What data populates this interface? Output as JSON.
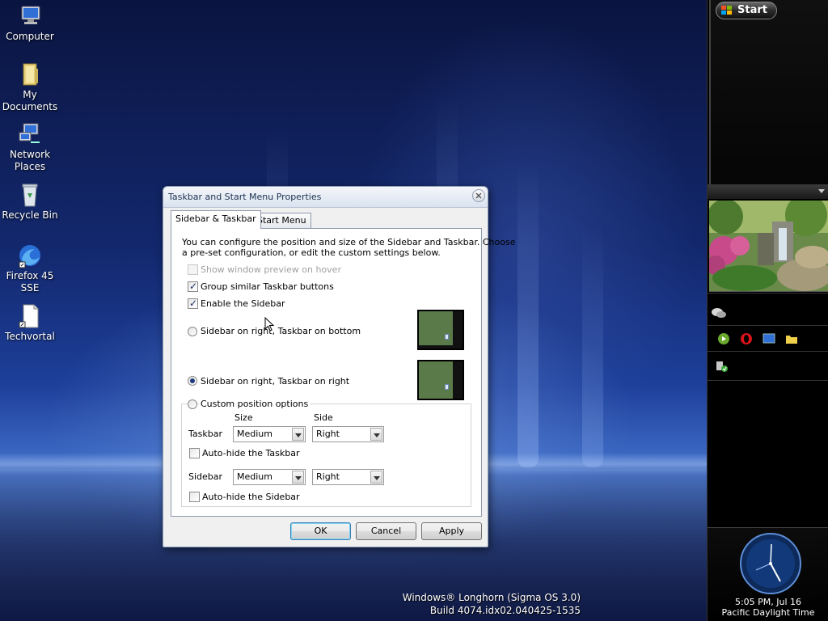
{
  "desktop": {
    "icons": [
      {
        "label": "Computer",
        "icon": "computer-icon"
      },
      {
        "label": "My Documents",
        "icon": "folder-icon"
      },
      {
        "label": "Network Places",
        "icon": "network-icon"
      },
      {
        "label": "Recycle Bin",
        "icon": "recycle-bin-icon"
      },
      {
        "label": "Firefox 45 SSE",
        "icon": "firefox-icon"
      },
      {
        "label": "Techvortal",
        "icon": "document-icon"
      }
    ],
    "watermark_line1": "Windows® Longhorn (Sigma OS 3.0)",
    "watermark_line2": "Build 4074.idx02.040425-1535"
  },
  "sidebar": {
    "start_label": "Start",
    "clock_time": "5:05 PM, Jul 16",
    "clock_zone": "Pacific Daylight Time"
  },
  "dialog": {
    "title": "Taskbar and Start Menu Properties",
    "tabs": [
      "Sidebar & Taskbar",
      "Start Menu"
    ],
    "active_tab": 0,
    "description": "You can configure the position and size of the Sidebar and Taskbar. Choose a pre-set configuration, or edit the custom settings below.",
    "description_line1": "You can configure the position and size of the Sidebar and Taskbar. Choose",
    "description_line2": "a pre-set configuration, or edit the custom settings below.",
    "options": {
      "show_preview": {
        "label": "Show window preview on hover",
        "checked": false,
        "disabled": true
      },
      "group_buttons": {
        "label": "Group similar Taskbar buttons",
        "checked": true
      },
      "enable_sidebar": {
        "label": "Enable the Sidebar",
        "checked": true
      }
    },
    "positions": {
      "right_bottom": {
        "label": "Sidebar on right, Taskbar on bottom",
        "selected": false
      },
      "right_right": {
        "label": "Sidebar on right, Taskbar on right",
        "selected": true
      },
      "custom": {
        "label": "Custom position options",
        "selected": false
      }
    },
    "custom": {
      "size_header": "Size",
      "side_header": "Side",
      "taskbar_label": "Taskbar",
      "taskbar_size": "Medium",
      "taskbar_side": "Right",
      "autohide_taskbar": "Auto-hide the Taskbar",
      "sidebar_label": "Sidebar",
      "sidebar_size": "Medium",
      "sidebar_side": "Right",
      "autohide_sidebar": "Auto-hide the Sidebar"
    },
    "buttons": {
      "ok": "OK",
      "cancel": "Cancel",
      "apply": "Apply"
    }
  },
  "colors": {
    "desktop_blue": "#13286d",
    "sidebar_black": "#000000",
    "dialog_face": "#f0f0f0",
    "default_button_border": "#3c7fb1"
  }
}
